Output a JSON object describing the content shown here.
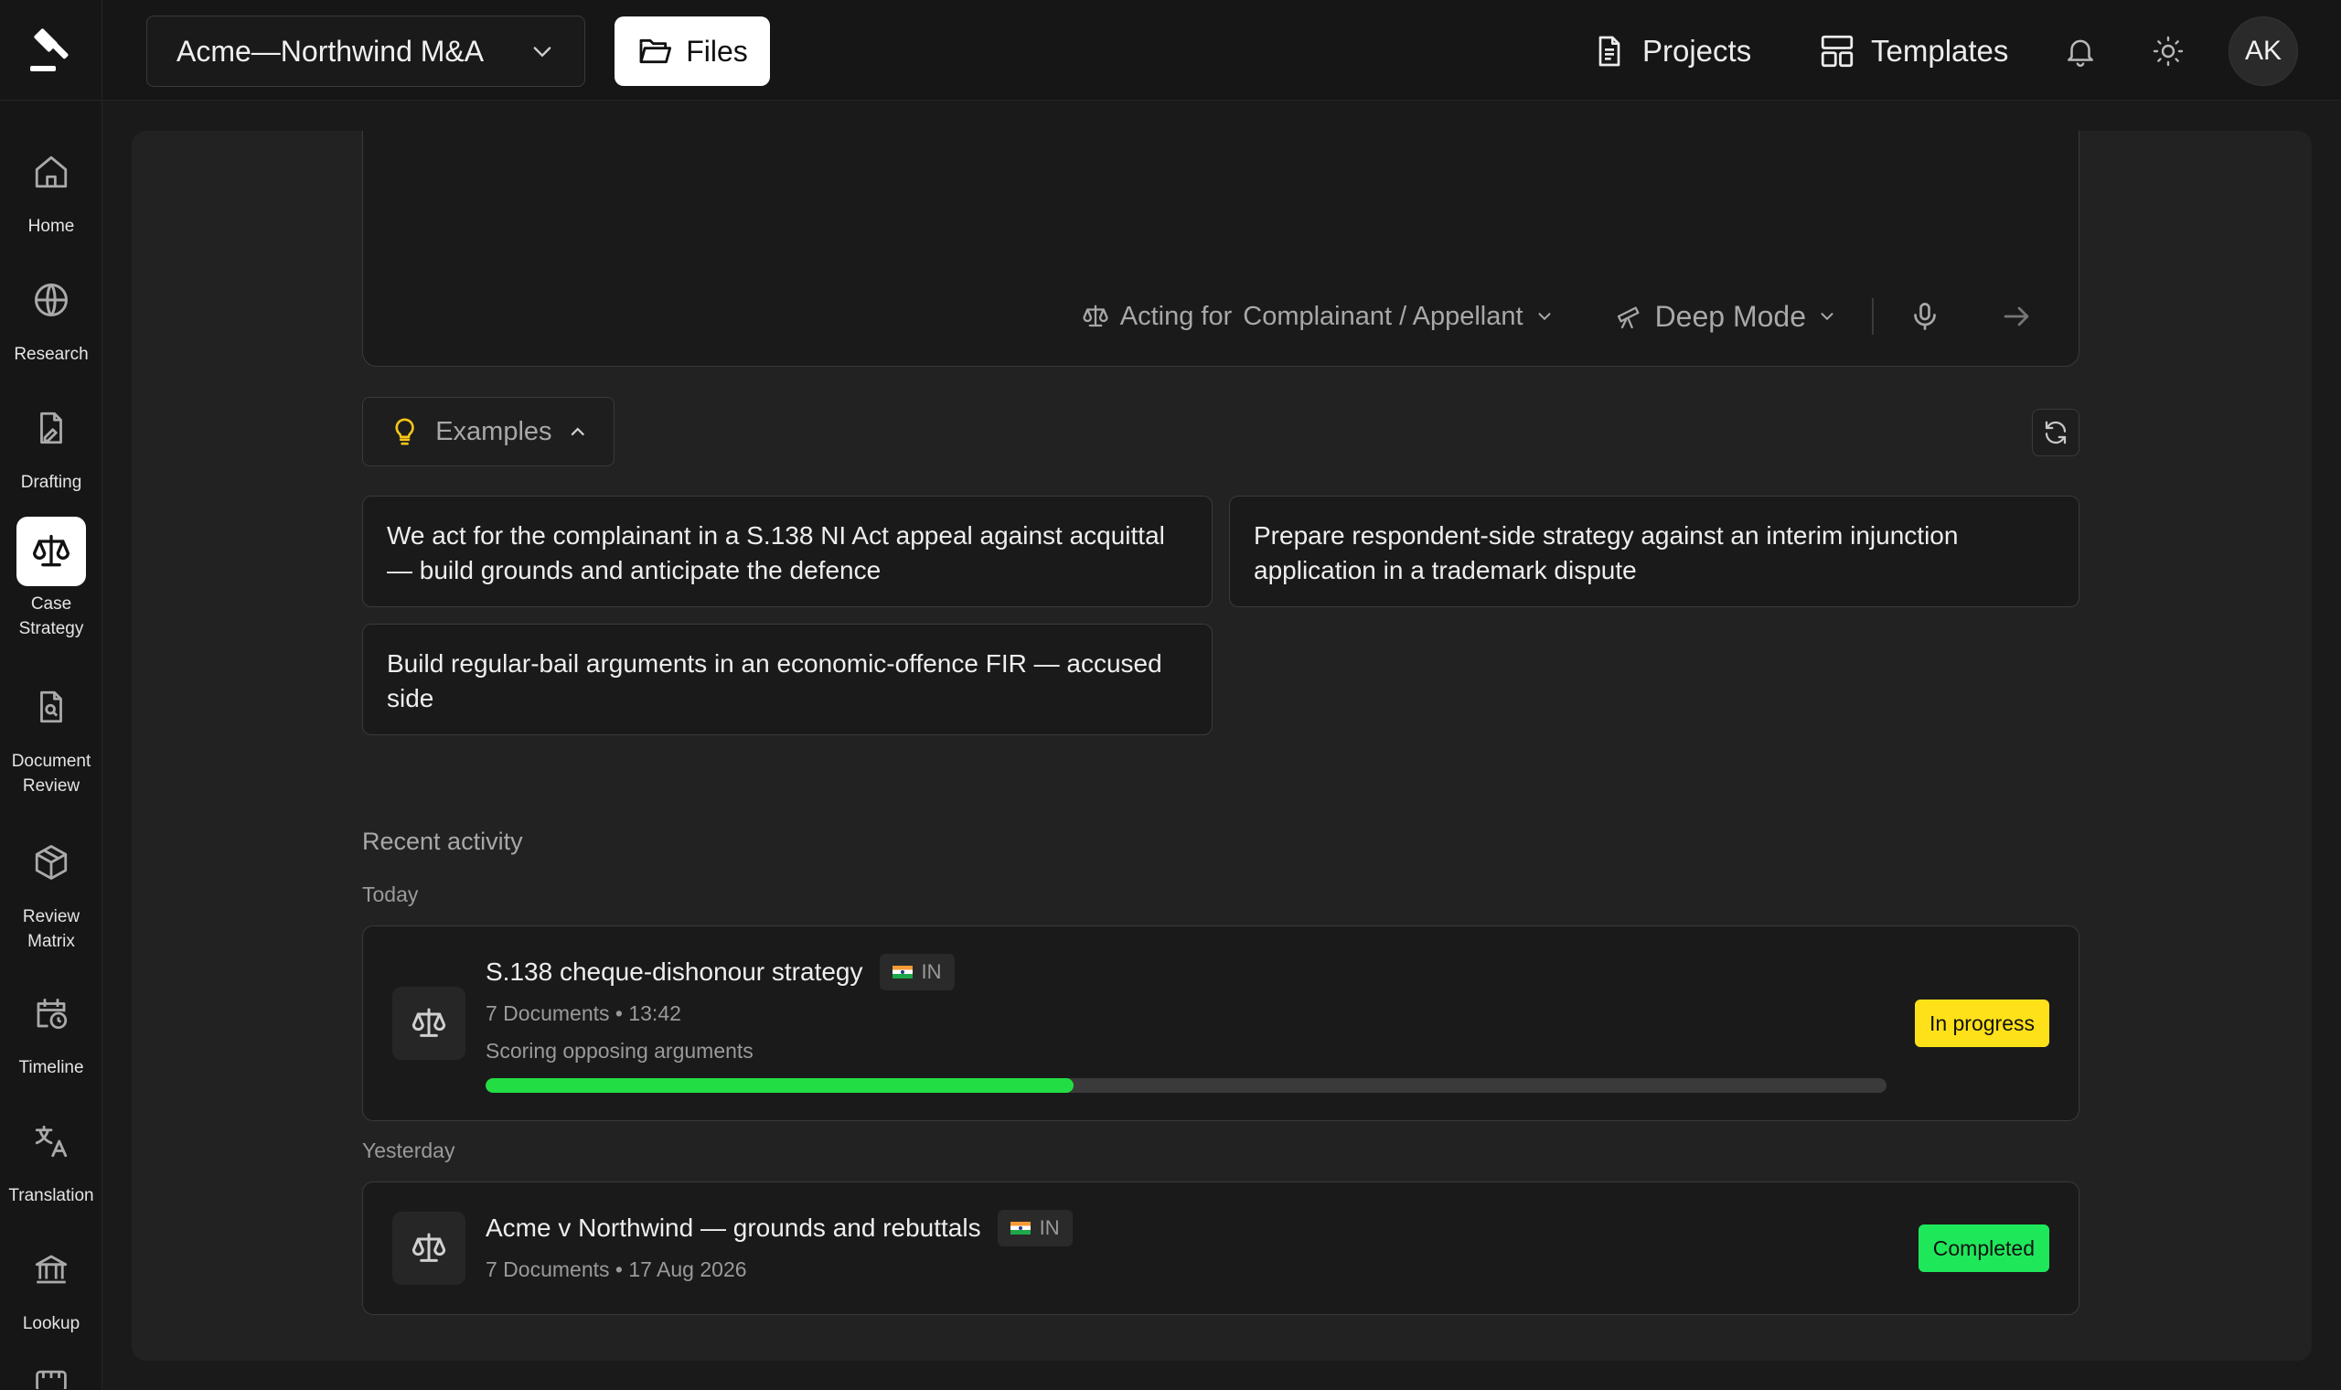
{
  "topbar": {
    "project_name": "Acme—Northwind M&A",
    "files_label": "Files",
    "projects_label": "Projects",
    "templates_label": "Templates",
    "avatar_initials": "AK"
  },
  "sidebar": {
    "items": [
      {
        "label": "Home",
        "icon": "home-icon"
      },
      {
        "label": "Research",
        "icon": "globe-icon"
      },
      {
        "label": "Drafting",
        "icon": "draft-icon"
      },
      {
        "label": "Case Strategy",
        "icon": "scales-icon",
        "active": true
      },
      {
        "label": "Document Review",
        "icon": "document-search-icon"
      },
      {
        "label": "Review Matrix",
        "icon": "cube-icon"
      },
      {
        "label": "Timeline",
        "icon": "calendar-clock-icon"
      },
      {
        "label": "Translation",
        "icon": "translate-icon"
      },
      {
        "label": "Lookup",
        "icon": "bank-icon"
      }
    ]
  },
  "prompt": {
    "acting_for_label": "Acting for",
    "acting_for_value": "Complainant / Appellant",
    "mode_label": "Deep Mode"
  },
  "examples": {
    "toggle_label": "Examples",
    "items": [
      "We act for the complainant in a S.138 NI Act appeal against acquittal — build grounds and anticipate the defence",
      "Prepare respondent-side strategy against an interim injunction application in a trademark dispute",
      "Build regular-bail arguments in an economic-offence FIR — accused side"
    ]
  },
  "recent": {
    "title": "Recent activity",
    "groups": [
      {
        "day": "Today",
        "items": [
          {
            "title": "S.138 cheque-dishonour strategy",
            "jurisdiction": "IN",
            "meta": "7 Documents • 13:42",
            "subtitle": "Scoring opposing arguments",
            "progress": 0.42,
            "status": "In progress",
            "status_color": "#ffe11a"
          }
        ]
      },
      {
        "day": "Yesterday",
        "items": [
          {
            "title": "Acme v Northwind — grounds and rebuttals",
            "jurisdiction": "IN",
            "meta": "7 Documents • 17 Aug 2026",
            "status": "Completed",
            "status_color": "#1ee85a"
          }
        ]
      }
    ]
  }
}
